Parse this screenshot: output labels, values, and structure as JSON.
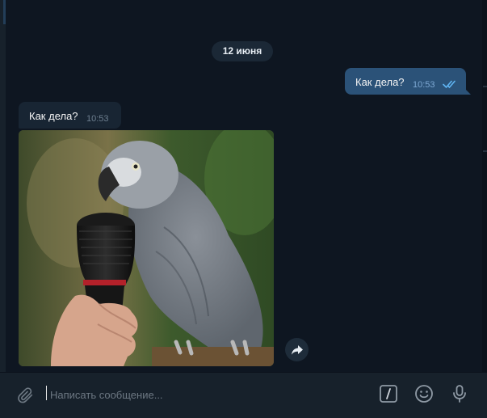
{
  "chat": {
    "date_separator": "12 июня",
    "messages": [
      {
        "direction": "outgoing",
        "text": "Как дела?",
        "time": "10:53",
        "status_icon": "double-check-icon"
      },
      {
        "direction": "incoming",
        "text": "Как дела?",
        "time": "10:53"
      },
      {
        "direction": "incoming",
        "type": "photo",
        "description_icon": "parrot-with-microphone-photo"
      }
    ]
  },
  "composer": {
    "placeholder": "Написать сообщение...",
    "icons": [
      "paperclip-icon",
      "bot-commands-icon",
      "emoji-icon",
      "microphone-icon"
    ]
  },
  "colors": {
    "background": "#0e1621",
    "outgoing_bubble": "#2b5278",
    "incoming_bubble": "#182533",
    "composer": "#17212b",
    "read_check": "#5fb4f2"
  }
}
